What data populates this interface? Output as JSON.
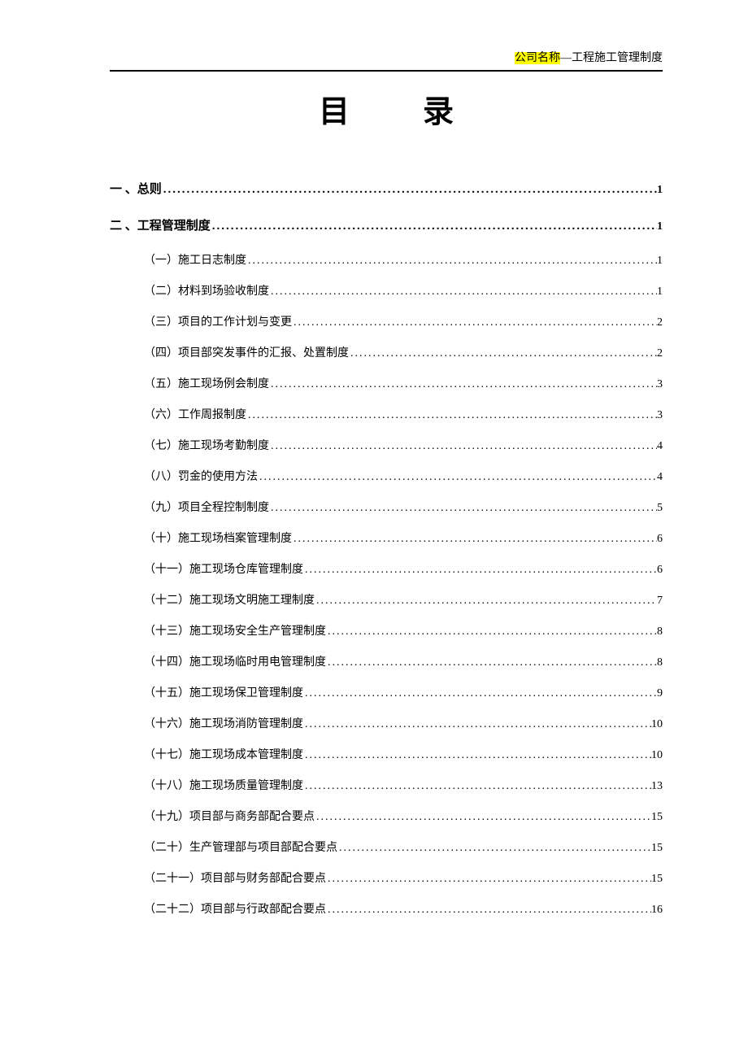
{
  "header": {
    "company_label": "公司名称",
    "doc_suffix": "—工程施工管理制度"
  },
  "title_left": "目",
  "title_right": "录",
  "toc": [
    {
      "level": 1,
      "label": "一 、总则 ",
      "page": "1"
    },
    {
      "level": 1,
      "label": "二 、工程管理制度 ",
      "page": "1"
    },
    {
      "level": 2,
      "label": "（一）施工日志制度",
      "page": "1"
    },
    {
      "level": 2,
      "label": "（二）材料到场验收制度",
      "page": "1"
    },
    {
      "level": 2,
      "label": "（三）项目的工作计划与变更",
      "page": "2"
    },
    {
      "level": 2,
      "label": "（四）项目部突发事件的汇报、处置制度",
      "page": "2"
    },
    {
      "level": 2,
      "label": "（五）施工现场例会制度",
      "page": "3"
    },
    {
      "level": 2,
      "label": "（六）工作周报制度",
      "page": "3"
    },
    {
      "level": 2,
      "label": "（七）施工现场考勤制度",
      "page": "4"
    },
    {
      "level": 2,
      "label": "（八）罚金的使用方法",
      "page": "4"
    },
    {
      "level": 2,
      "label": "（九）项目全程控制制度",
      "page": "5"
    },
    {
      "level": 2,
      "label": "（十）施工现场档案管理制度",
      "page": "6"
    },
    {
      "level": 2,
      "label": "（十一）施工现场仓库管理制度",
      "page": "6"
    },
    {
      "level": 2,
      "label": "（十二）施工现场文明施工理制度",
      "page": "7"
    },
    {
      "level": 2,
      "label": "（十三）施工现场安全生产管理制度",
      "page": "8"
    },
    {
      "level": 2,
      "label": "（十四）施工现场临时用电管理制度",
      "page": "8"
    },
    {
      "level": 2,
      "label": "（十五）施工现场保卫管理制度",
      "page": "9"
    },
    {
      "level": 2,
      "label": "（十六）施工现场消防管理制度",
      "page": "10"
    },
    {
      "level": 2,
      "label": "（十七）施工现场成本管理制度",
      "page": "10"
    },
    {
      "level": 2,
      "label": "（十八）施工现场质量管理制度",
      "page": "13"
    },
    {
      "level": 2,
      "label": "（十九）项目部与商务部配合要点",
      "page": "15"
    },
    {
      "level": 2,
      "label": "（二十）生产管理部与项目部配合要点",
      "page": "15"
    },
    {
      "level": 2,
      "label": "（二十一）项目部与财务部配合要点",
      "page": "15"
    },
    {
      "level": 2,
      "label": "（二十二）项目部与行政部配合要点",
      "page": "16"
    }
  ]
}
